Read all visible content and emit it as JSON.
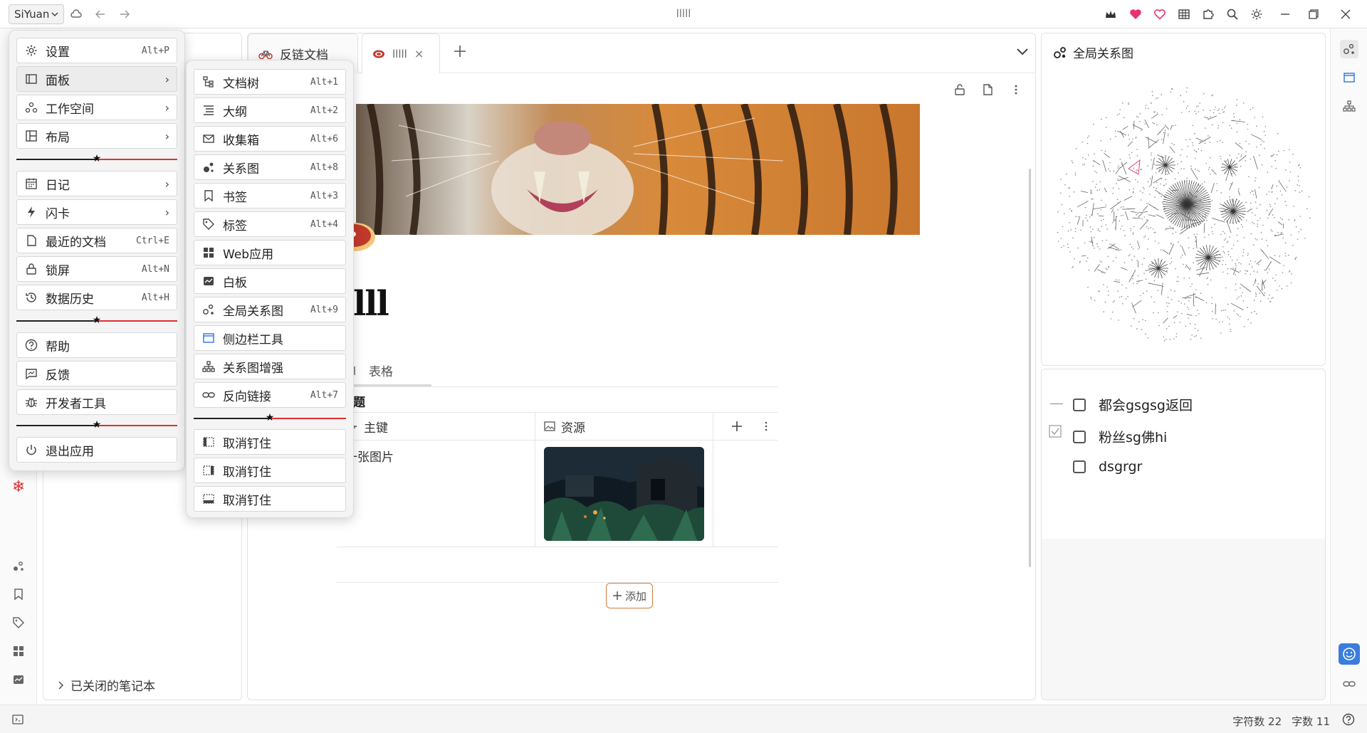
{
  "titlebar": {
    "app_name": "SiYuan",
    "window_title": "lllll"
  },
  "main_menu": {
    "items": [
      {
        "label": "设置",
        "shortcut": "Alt+P",
        "icon": "gear-icon"
      },
      {
        "label": "面板",
        "icon": "panel-icon",
        "submenu": true
      },
      {
        "label": "工作空间",
        "icon": "workspace-icon",
        "submenu": true
      },
      {
        "label": "布局",
        "icon": "layout-icon",
        "submenu": true
      },
      {
        "label": "日记",
        "icon": "calendar-icon",
        "submenu": true
      },
      {
        "label": "闪卡",
        "icon": "flash-icon",
        "submenu": true
      },
      {
        "label": "最近的文档",
        "shortcut": "Ctrl+E",
        "icon": "document-icon"
      },
      {
        "label": "锁屏",
        "shortcut": "Alt+N",
        "icon": "lock-icon"
      },
      {
        "label": "数据历史",
        "shortcut": "Alt+H",
        "icon": "history-icon"
      },
      {
        "label": "帮助",
        "icon": "help-icon"
      },
      {
        "label": "反馈",
        "icon": "feedback-icon"
      },
      {
        "label": "开发者工具",
        "icon": "bug-icon"
      },
      {
        "label": "退出应用",
        "icon": "power-icon"
      }
    ]
  },
  "panel_submenu": {
    "items": [
      {
        "label": "文档树",
        "shortcut": "Alt+1",
        "icon": "filetree-icon"
      },
      {
        "label": "大纲",
        "shortcut": "Alt+2",
        "icon": "outline-icon"
      },
      {
        "label": "收集箱",
        "shortcut": "Alt+6",
        "icon": "inbox-icon"
      },
      {
        "label": "关系图",
        "shortcut": "Alt+8",
        "icon": "graph-icon"
      },
      {
        "label": "书签",
        "shortcut": "Alt+3",
        "icon": "bookmark-icon"
      },
      {
        "label": "标签",
        "shortcut": "Alt+4",
        "icon": "tag-icon"
      },
      {
        "label": "Web应用",
        "icon": "apps-icon"
      },
      {
        "label": "白板",
        "icon": "whiteboard-icon"
      },
      {
        "label": "全局关系图",
        "shortcut": "Alt+9",
        "icon": "global-graph-icon"
      },
      {
        "label": "侧边栏工具",
        "icon": "sidebar-tool-icon"
      },
      {
        "label": "关系图增强",
        "icon": "graph-enhance-icon"
      },
      {
        "label": "反向链接",
        "shortcut": "Alt+7",
        "icon": "backlink-icon"
      },
      {
        "label": "取消钉住",
        "icon": "unpin-left-icon"
      },
      {
        "label": "取消钉住",
        "icon": "unpin-right-icon"
      },
      {
        "label": "取消钉住",
        "icon": "unpin-bottom-icon"
      }
    ]
  },
  "tabs": [
    {
      "label": "反链文档",
      "icon": "bicycle-icon",
      "active": false
    },
    {
      "label": "lllll",
      "icon": "meat-icon",
      "active": true,
      "close": "×"
    }
  ],
  "filetree": {
    "closed_notebooks": "已关闭的笔记本"
  },
  "document": {
    "title": "lll",
    "view_tab": "表格",
    "db_title": "题",
    "columns": [
      {
        "label": "主键",
        "icon": "key-icon"
      },
      {
        "label": "资源",
        "icon": "image-icon"
      }
    ],
    "rows": [
      {
        "primary": "一张图片",
        "asset": "forest-cabin-image"
      }
    ],
    "add_button": "添加"
  },
  "graph_panel": {
    "title": "全局关系图"
  },
  "todo_panel": {
    "items": [
      {
        "label": "都会gsgsg返回",
        "checked": false
      },
      {
        "label": "粉丝sg佛hi",
        "checked": false
      },
      {
        "label": "dsgrgr",
        "checked": false
      }
    ]
  },
  "statusbar": {
    "char_count": "字符数 22",
    "word_count": "字数 11"
  },
  "colors": {
    "accent_pink": "#e8346b",
    "accent_blue": "#3b7ddd",
    "separator_red": "#e03030",
    "add_button_border": "#d97b3a"
  }
}
